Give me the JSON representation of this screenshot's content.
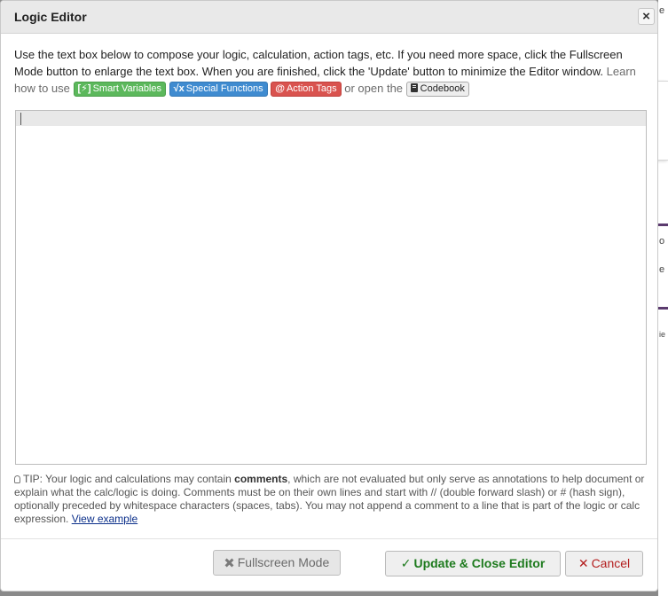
{
  "dialog": {
    "title": "Logic Editor",
    "close_symbol": "×"
  },
  "intro": {
    "text": "Use the text box below to compose your logic, calculation, action tags, etc. If you need more space, click the Fullscreen Mode button to enlarge the text box. When you are finished, click the 'Update' button to minimize the Editor window.",
    "learn_prefix": "Learn how to use",
    "smart_variables": {
      "icon": "[⚡]",
      "label": "Smart Variables"
    },
    "special_functions": {
      "icon": "√x",
      "label": "Special Functions"
    },
    "action_tags": {
      "icon": "@",
      "label": "Action Tags"
    },
    "open_text": "or open the",
    "codebook": {
      "icon": "book-icon",
      "label": "Codebook"
    }
  },
  "editor": {
    "value": ""
  },
  "tip": {
    "prefix": "TIP: Your logic and calculations may contain ",
    "bold": "comments",
    "body": ", which are not evaluated but only serve as annotations to help document or explain what the calc/logic is doing. Comments must be on their own lines and start with // (double forward slash) or # (hash sign), optionally preceded by whitespace characters (spaces, tabs). You may not append a comment to a line that is part of the logic or calc expression. ",
    "link": "View example"
  },
  "footer": {
    "fullscreen_label": "Fullscreen Mode",
    "update_label": "Update & Close Editor",
    "update_icon": "✓",
    "cancel_label": "Cancel",
    "cancel_icon": "✕"
  },
  "background": {
    "fragments": [
      "e",
      "o",
      "e",
      "ie"
    ]
  },
  "colors": {
    "smart_variables": "#5cb85c",
    "special_functions": "#3f8bd0",
    "action_tags": "#d9534f",
    "update_text": "#1d7a1d",
    "cancel_text": "#b41e1e"
  }
}
